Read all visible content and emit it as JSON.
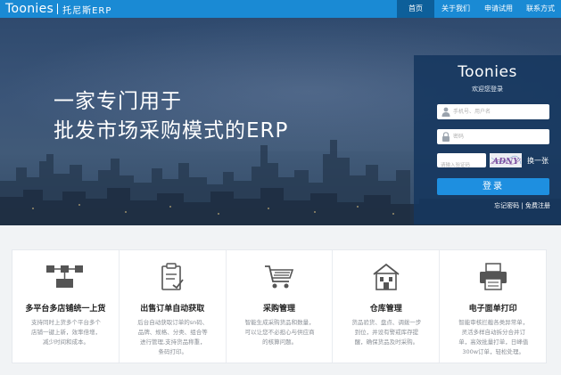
{
  "header": {
    "logo_word": "Toonies",
    "logo_sub": "托尼斯ERP",
    "nav": [
      {
        "label": "首页",
        "active": true
      },
      {
        "label": "关于我们",
        "active": false
      },
      {
        "label": "申请试用",
        "active": false
      },
      {
        "label": "联系方式",
        "active": false
      }
    ]
  },
  "hero": {
    "slogan_line1": "一家专门用于",
    "slogan_line2": "批发市场采购模式的ERP"
  },
  "login": {
    "logo": "Toonies",
    "welcome": "欢迎您登录",
    "username_placeholder": "手机号、用户名",
    "password_placeholder": "密码",
    "captcha_placeholder": "请输入验证码",
    "captcha_text": "ADNY",
    "refresh": "换一张",
    "submit": "登录",
    "forgot": "忘记密码",
    "register": "免费注册",
    "link_separator": "|"
  },
  "features": [
    {
      "title": "多平台多店铺统一上货",
      "desc": "支持同时上货多个平台多个店铺一键上新，效率倍增，减少时间和成本。",
      "icon": "network-icon"
    },
    {
      "title": "出售订单自动获取",
      "desc": "后台自动获取订单的sn码、品牌、规格、分类、组合等进行管理,支持货品称重，条码打印。",
      "icon": "clipboard-check-icon"
    },
    {
      "title": "采购管理",
      "desc": "智能生成采购货品和数量，可以让您不必担心与供应商的核算问题。",
      "icon": "shopping-cart-icon"
    },
    {
      "title": "仓库管理",
      "desc": "货品验货、盘点、调拨一步到位，并设有警戒库存提醒，确保货品及时采购。",
      "icon": "warehouse-icon"
    },
    {
      "title": "电子面单打印",
      "desc": "智能审核拦截各类异常单，灵活多样自动拆分合并订单，高效批量打单，日峰值300w订单，轻松处理。",
      "icon": "printer-icon"
    }
  ],
  "colors": {
    "topbar": "#1a8ad4",
    "nav_active": "#0d5f9a",
    "login_button": "#1e8fe0",
    "login_panel": "#16375f"
  }
}
